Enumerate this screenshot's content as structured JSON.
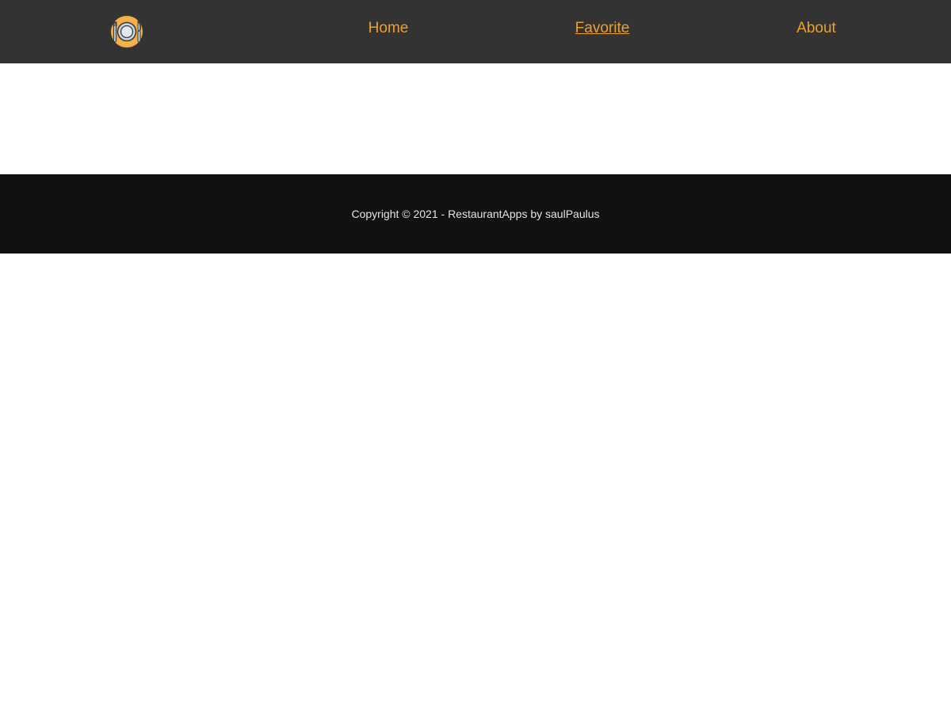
{
  "navbar": {
    "logo_icon": "restaurant-plate-icon",
    "links": [
      {
        "label": "Home",
        "active": false
      },
      {
        "label": "Favorite",
        "active": true
      },
      {
        "label": "About",
        "active": false
      }
    ],
    "colors": {
      "background": "#333333",
      "link": "#ee9f2e"
    }
  },
  "footer": {
    "text": "Copyright © 2021 - RestaurantApps by saulPaulus",
    "colors": {
      "background": "#111111",
      "text": "#e4e4e4"
    }
  },
  "colors": {
    "page_background": "#ffffff",
    "logo_orange": "#f4b04a",
    "logo_plate": "#c9d6e0",
    "logo_outline": "#3a3a3a"
  }
}
